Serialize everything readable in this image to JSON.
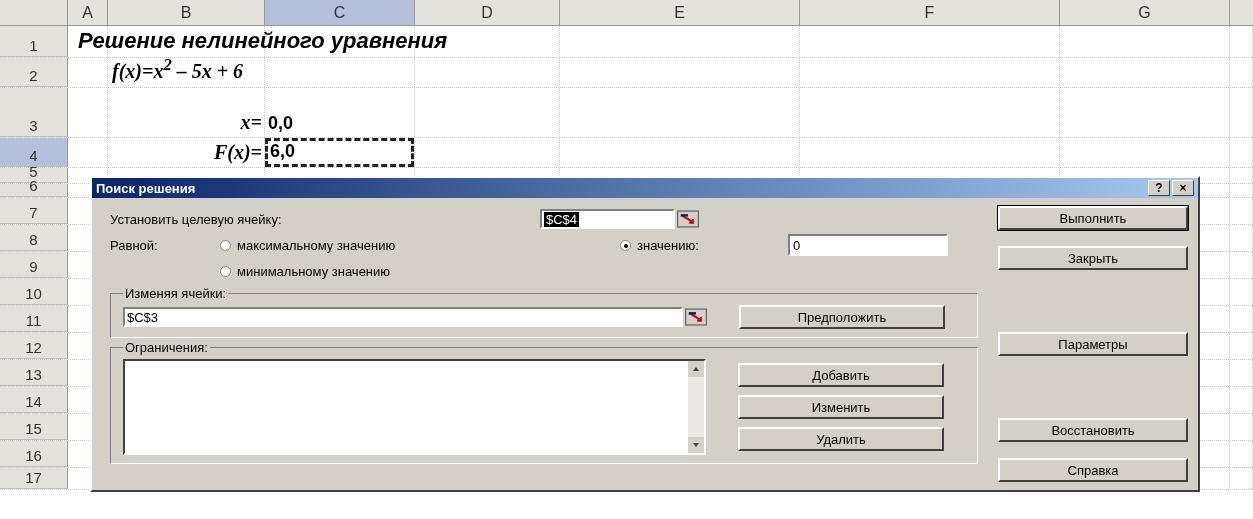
{
  "spreadsheet": {
    "columns": [
      {
        "label": "A",
        "selected": false
      },
      {
        "label": "B",
        "selected": false
      },
      {
        "label": "C",
        "selected": true
      },
      {
        "label": "D",
        "selected": false
      },
      {
        "label": "E",
        "selected": false
      },
      {
        "label": "F",
        "selected": false
      },
      {
        "label": "G",
        "selected": false
      }
    ],
    "rows": [
      {
        "label": "1",
        "selected": false,
        "cells": [
          {
            "kind": "title",
            "text": "Решение нелинейного уравнения"
          }
        ]
      },
      {
        "label": "2",
        "selected": false,
        "cells": [
          {
            "kind": "formula",
            "text": "f(x)=x$^{2}$ – 5x + 6"
          }
        ]
      },
      {
        "label": "3",
        "selected": false,
        "cells": [
          {
            "kind": "label",
            "text": "x="
          },
          {
            "kind": "value",
            "text": "0,0"
          }
        ]
      },
      {
        "label": "4",
        "selected": true,
        "cells": [
          {
            "kind": "label",
            "text": "F(x)="
          },
          {
            "kind": "marquee",
            "text": "6,0"
          }
        ]
      },
      {
        "label": "5",
        "selected": false,
        "cells": []
      },
      {
        "label": "6",
        "selected": false,
        "cells": []
      },
      {
        "label": "7",
        "selected": false,
        "cells": []
      },
      {
        "label": "8",
        "selected": false,
        "cells": []
      },
      {
        "label": "9",
        "selected": false,
        "cells": []
      },
      {
        "label": "10",
        "selected": false,
        "cells": []
      },
      {
        "label": "11",
        "selected": false,
        "cells": []
      },
      {
        "label": "12",
        "selected": false,
        "cells": []
      },
      {
        "label": "13",
        "selected": false,
        "cells": []
      },
      {
        "label": "14",
        "selected": false,
        "cells": []
      },
      {
        "label": "15",
        "selected": false,
        "cells": []
      },
      {
        "label": "16",
        "selected": false,
        "cells": []
      },
      {
        "label": "17",
        "selected": false,
        "cells": []
      }
    ]
  },
  "dialog": {
    "title": "Поиск решения",
    "help_button": "?",
    "close_button": "×",
    "target_label": "Установить целевую ячейку:",
    "target_value": "$C$4",
    "target_highlighted": true,
    "equal_label": "Равной:",
    "options": [
      {
        "label": "максимальному значению",
        "selected": false
      },
      {
        "label": "значению:",
        "selected": true
      },
      {
        "label": "минимальному значению",
        "selected": false
      }
    ],
    "value_field": "0",
    "changing_label": "Изменяя ячейки:",
    "changing_value": "$C$3",
    "guess_button": "Предположить",
    "constraints_label": "Ограничения:",
    "constraint_buttons": [
      "Добавить",
      "Изменить",
      "Удалить"
    ],
    "buttons_top": [
      {
        "label": "Выполнить",
        "default": true
      },
      {
        "label": "Закрыть",
        "default": false
      }
    ],
    "buttons_middle": [
      {
        "label": "Параметры",
        "default": false
      }
    ],
    "buttons_bottom": [
      {
        "label": "Восстановить",
        "default": false
      },
      {
        "label": "Справка",
        "default": false
      }
    ]
  }
}
